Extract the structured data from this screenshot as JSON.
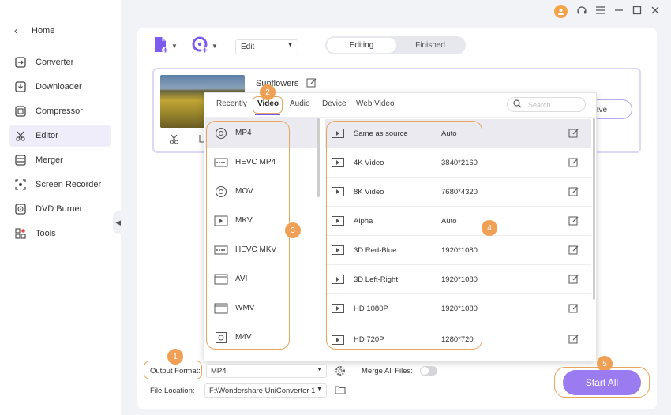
{
  "sidebar": {
    "home_label": "Home",
    "items": [
      {
        "label": "Converter"
      },
      {
        "label": "Downloader"
      },
      {
        "label": "Compressor"
      },
      {
        "label": "Editor"
      },
      {
        "label": "Merger"
      },
      {
        "label": "Screen Recorder"
      },
      {
        "label": "DVD Burner"
      },
      {
        "label": "Tools"
      }
    ]
  },
  "toolbar": {
    "edit_select": "Edit",
    "seg_editing": "Editing",
    "seg_finished": "Finished"
  },
  "file": {
    "name": "Sunflowers",
    "save_label": "ave"
  },
  "popup": {
    "tabs": [
      "Recently",
      "Video",
      "Audio",
      "Device",
      "Web Video"
    ],
    "active_tab": "Video",
    "search_placeholder": "Search",
    "formats": [
      "MP4",
      "HEVC MP4",
      "MOV",
      "MKV",
      "HEVC MKV",
      "AVI",
      "WMV",
      "M4V"
    ],
    "selected_format": "MP4",
    "presets": [
      {
        "name": "Same as source",
        "res": "Auto"
      },
      {
        "name": "4K Video",
        "res": "3840*2160"
      },
      {
        "name": "8K Video",
        "res": "7680*4320"
      },
      {
        "name": "Alpha",
        "res": "Auto"
      },
      {
        "name": "3D Red-Blue",
        "res": "1920*1080"
      },
      {
        "name": "3D Left-Right",
        "res": "1920*1080"
      },
      {
        "name": "HD 1080P",
        "res": "1920*1080"
      },
      {
        "name": "HD 720P",
        "res": "1280*720"
      }
    ]
  },
  "badges": [
    "1",
    "2",
    "3",
    "4",
    "5"
  ],
  "bottom": {
    "output_format_label": "Output Format:",
    "output_format_value": "MP4",
    "merge_label": "Merge All Files:",
    "file_location_label": "File Location:",
    "file_location_value": "F:\\Wondershare UniConverter 1",
    "start_all": "Start All"
  },
  "colors": {
    "accent": "#9a7cf0",
    "highlight": "#e8a55f",
    "badge": "#f0a054"
  }
}
